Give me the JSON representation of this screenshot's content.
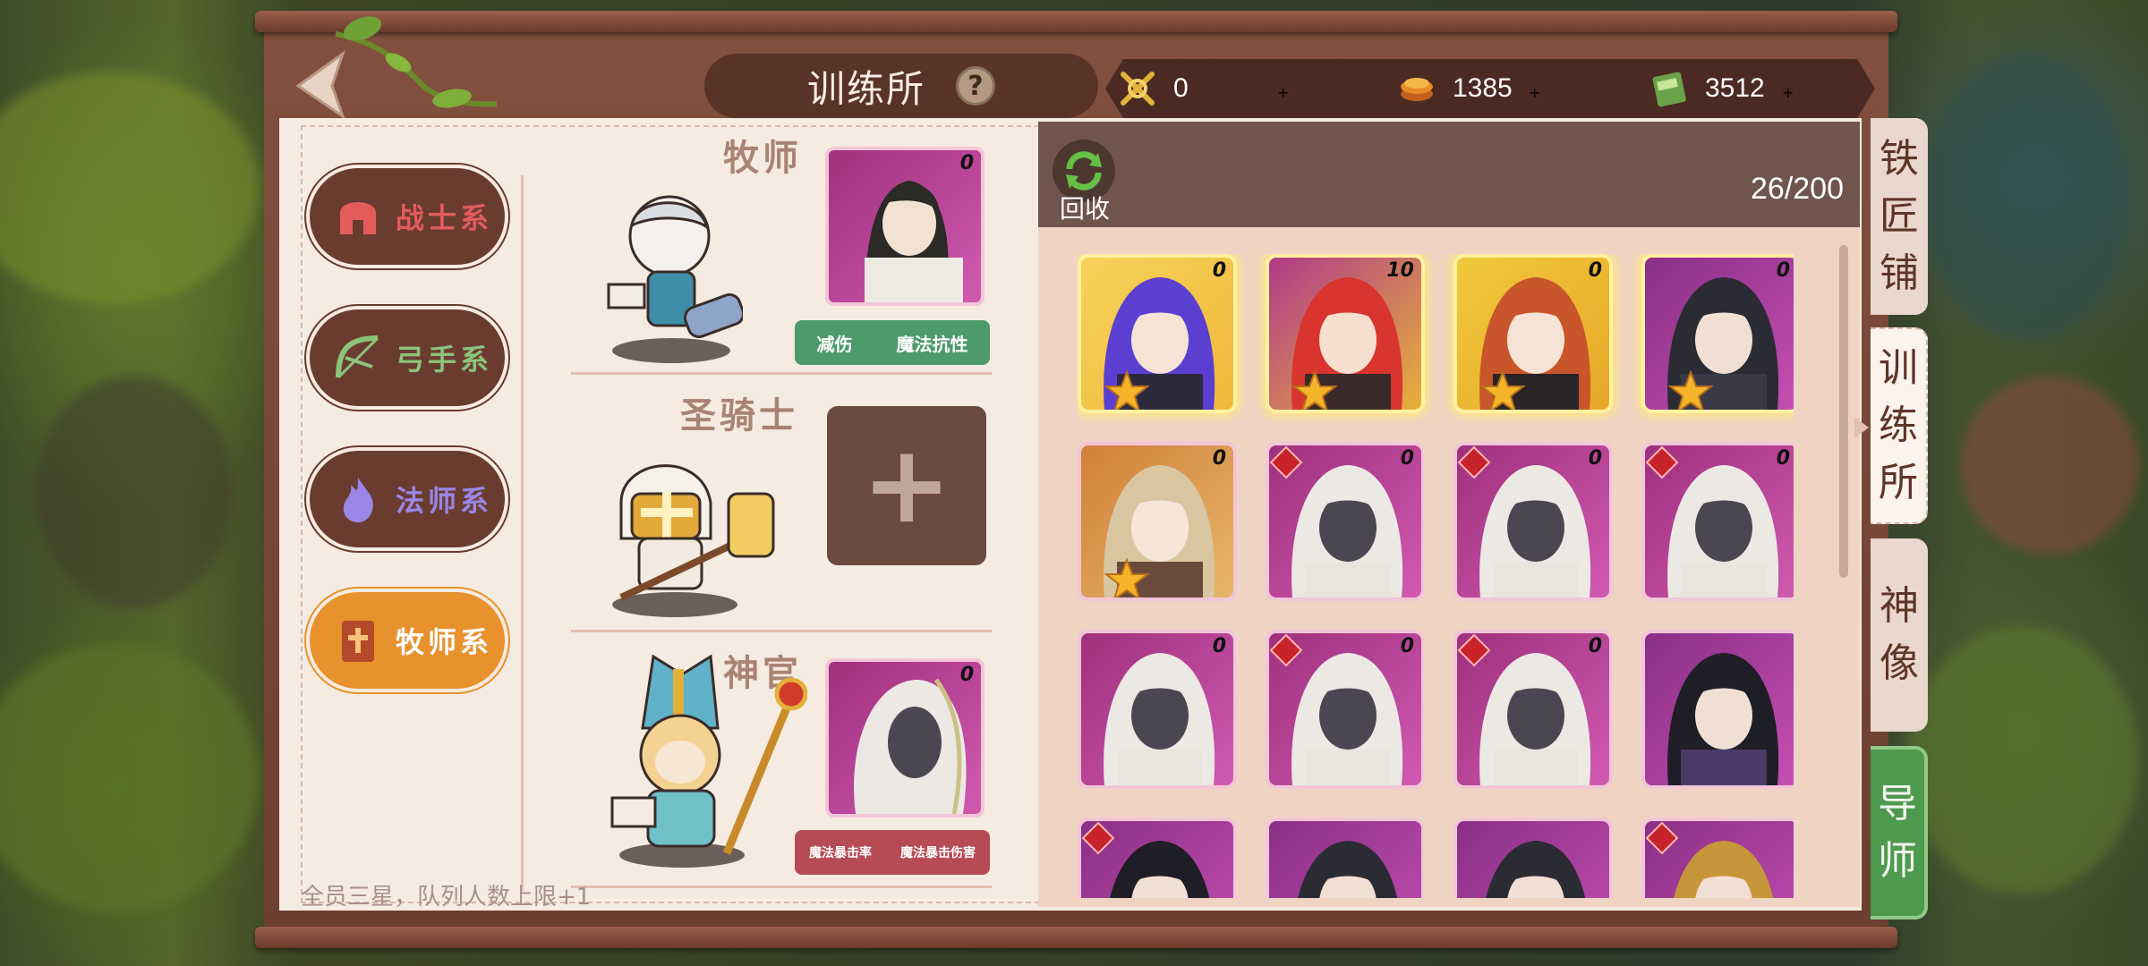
{
  "header": {
    "title": "训练所",
    "help_label": "?"
  },
  "resources": [
    {
      "name": "crossed-swords",
      "value": "0",
      "plus": "+"
    },
    {
      "name": "gold-coin",
      "value": "1385",
      "plus": "+"
    },
    {
      "name": "exp-book",
      "value": "3512",
      "plus": "+"
    }
  ],
  "classes": [
    {
      "label": "战士系",
      "color": "#e45b5b",
      "active": false
    },
    {
      "label": "弓手系",
      "color": "#8bc37a",
      "active": false
    },
    {
      "label": "法师系",
      "color": "#9a86e6",
      "active": false
    },
    {
      "label": "牧师系",
      "color": "#ffffff",
      "active": true
    }
  ],
  "slots": [
    {
      "title": "牧师",
      "tags": [
        "减伤",
        "魔法抗性"
      ],
      "tag_color": "green",
      "level": "0"
    },
    {
      "title": "圣骑士",
      "tags": [],
      "add": "+"
    },
    {
      "title": "神官",
      "tags": [
        "魔法暴击率",
        "魔法暴击伤害"
      ],
      "tag_color": "red",
      "level": "0"
    }
  ],
  "footer_note": "全员三星，队列人数上限+1",
  "inventory": {
    "recycle_label": "回收",
    "count": "26/200",
    "cards": [
      {
        "level": "0",
        "theme": "purple-hair",
        "star": true,
        "gold": true
      },
      {
        "level": "10",
        "theme": "red-hair",
        "star": true,
        "gold": true
      },
      {
        "level": "0",
        "theme": "ginger-hair",
        "star": true,
        "gold": true
      },
      {
        "level": "0",
        "theme": "dark-masked",
        "star": true,
        "gold": true
      },
      {
        "level": "0",
        "theme": "blonde-girl",
        "star": true,
        "gold": false
      },
      {
        "level": "0",
        "theme": "white-veil",
        "red": true
      },
      {
        "level": "0",
        "theme": "white-veil",
        "red": true
      },
      {
        "level": "0",
        "theme": "white-veil",
        "red": true
      },
      {
        "level": "0",
        "theme": "white-veil",
        "red": false
      },
      {
        "level": "0",
        "theme": "white-veil",
        "red": true
      },
      {
        "level": "0",
        "theme": "white-veil",
        "red": true
      },
      {
        "level": "",
        "theme": "dark-boy",
        "red": false
      },
      {
        "level": "",
        "theme": "dark-boy",
        "red": true
      },
      {
        "level": "",
        "theme": "dark-masked",
        "red": false
      },
      {
        "level": "",
        "theme": "dark-masked",
        "red": false
      },
      {
        "level": "",
        "theme": "blonde-man",
        "red": true
      }
    ]
  },
  "side_tabs": [
    {
      "label": [
        "铁",
        "匠",
        "铺"
      ],
      "active": false
    },
    {
      "label": [
        "训",
        "练",
        "所"
      ],
      "active": true
    },
    {
      "label": [
        "神",
        "像"
      ],
      "active": false
    },
    {
      "label": [
        "导",
        "师"
      ],
      "active": false,
      "green": true
    }
  ]
}
